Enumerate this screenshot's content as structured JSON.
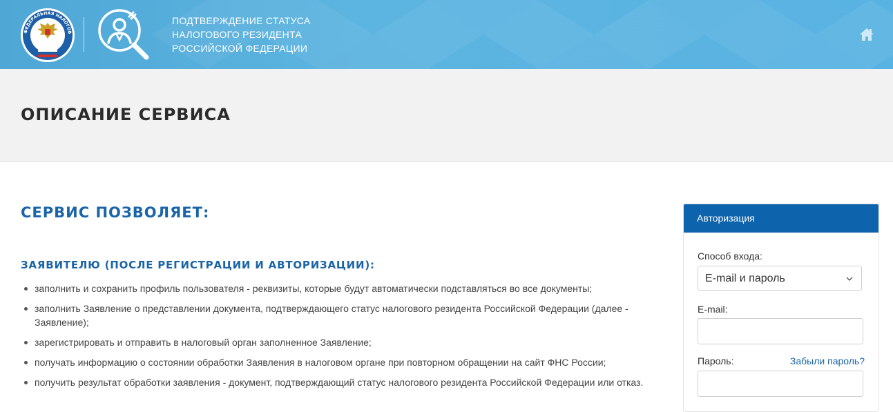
{
  "header": {
    "title_lines": [
      "ПОДТВЕРЖДЕНИЕ СТАТУСА",
      "НАЛОГОВОГО РЕЗИДЕНТА",
      "РОССИЙСКОЙ ФЕДЕРАЦИИ"
    ],
    "emblem_text": "ФЕДЕРАЛЬНАЯ НАЛОГОВАЯ СЛУЖБА",
    "logo_icon": "fns-emblem-icon",
    "service_icon": "person-wrench-magnifier-icon",
    "home_icon": "home-icon",
    "colors": {
      "gradient_start": "#4fa7d6",
      "gradient_end": "#59b3e2"
    }
  },
  "page": {
    "title": "ОПИСАНИЕ СЕРВИСА"
  },
  "main": {
    "section_title": "СЕРВИС ПОЗВОЛЯЕТ:",
    "subsection_title": "ЗАЯВИТЕЛЮ (ПОСЛЕ РЕГИСТРАЦИИ И АВТОРИЗАЦИИ):",
    "features": [
      "заполнить и сохранить профиль пользователя - реквизиты, которые будут автоматически подставляться во все документы;",
      "заполнить Заявление о представлении документа, подтверждающего статус налогового резидента Российской Федерации (далее - Заявление);",
      "зарегистрировать и отправить в налоговый орган заполненное Заявление;",
      "получать информацию о состоянии обработки Заявления в налоговом органе при повторном обращении на сайт ФНС России;",
      "получить результат обработки заявления - документ, подтверждающий статус налогового резидента Российской Федерации или отказ."
    ]
  },
  "auth": {
    "header": "Авторизация",
    "login_method_label": "Способ входа:",
    "login_method_value": "E-mail и пароль",
    "email_label": "E-mail:",
    "email_value": "",
    "password_label": "Пароль:",
    "password_value": "",
    "forgot_link": "Забыли пароль?",
    "colors": {
      "header_bg": "#0e63ad",
      "link": "#1a64a8"
    }
  }
}
